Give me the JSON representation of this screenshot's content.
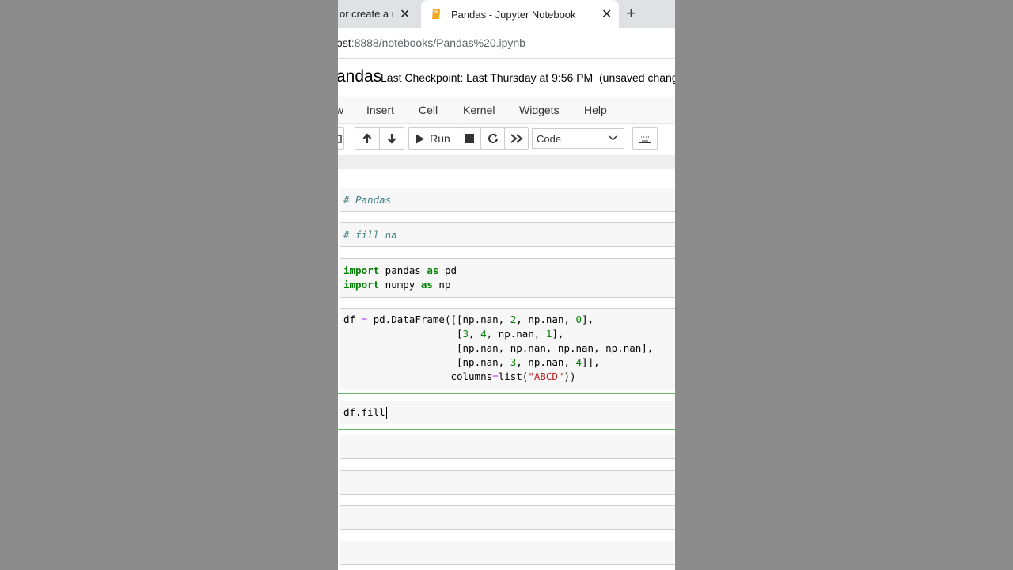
{
  "browser": {
    "tabs": [
      {
        "title": "or create a n",
        "active": false
      },
      {
        "title": "Pandas - Jupyter Notebook",
        "active": true
      }
    ],
    "url_prefix": "ost",
    "url_rest": ":8888/notebooks/Pandas%20.ipynb"
  },
  "notebook": {
    "name": "andas",
    "checkpoint": "Last Checkpoint: Last Thursday at 9:56 PM",
    "unsaved": "(unsaved chang"
  },
  "menubar": {
    "items": [
      "w",
      "Insert",
      "Cell",
      "Kernel",
      "Widgets",
      "Help"
    ]
  },
  "toolbar": {
    "run_label": "Run",
    "cell_type": "Code"
  },
  "cells": {
    "c1": "# Pandas",
    "c2": "# fill na",
    "c3": {
      "l1": {
        "kw1": "import",
        "mod": " pandas ",
        "kw2": "as",
        "alias": " pd"
      },
      "l2": {
        "kw1": "import",
        "mod": " numpy ",
        "kw2": "as",
        "alias": " np"
      }
    },
    "c4": {
      "l1a": "df ",
      "l1op": "=",
      "l1b": " pd.DataFrame([[np.nan, ",
      "l1n1": "2",
      "l1c": ", np.nan, ",
      "l1n2": "0",
      "l1d": "],",
      "l2a": "                   [",
      "l2n1": "3",
      "l2b": ", ",
      "l2n2": "4",
      "l2c": ", np.nan, ",
      "l2n3": "1",
      "l2d": "],",
      "l3": "                   [np.nan, np.nan, np.nan, np.nan],",
      "l4a": "                   [np.nan, ",
      "l4n1": "3",
      "l4b": ", np.nan, ",
      "l4n2": "4",
      "l4c": "]],",
      "l5a": "                  columns",
      "l5op": "=",
      "l5b": "list(",
      "l5s": "\"ABCD\"",
      "l5c": "))"
    },
    "c5": "df.fill"
  }
}
